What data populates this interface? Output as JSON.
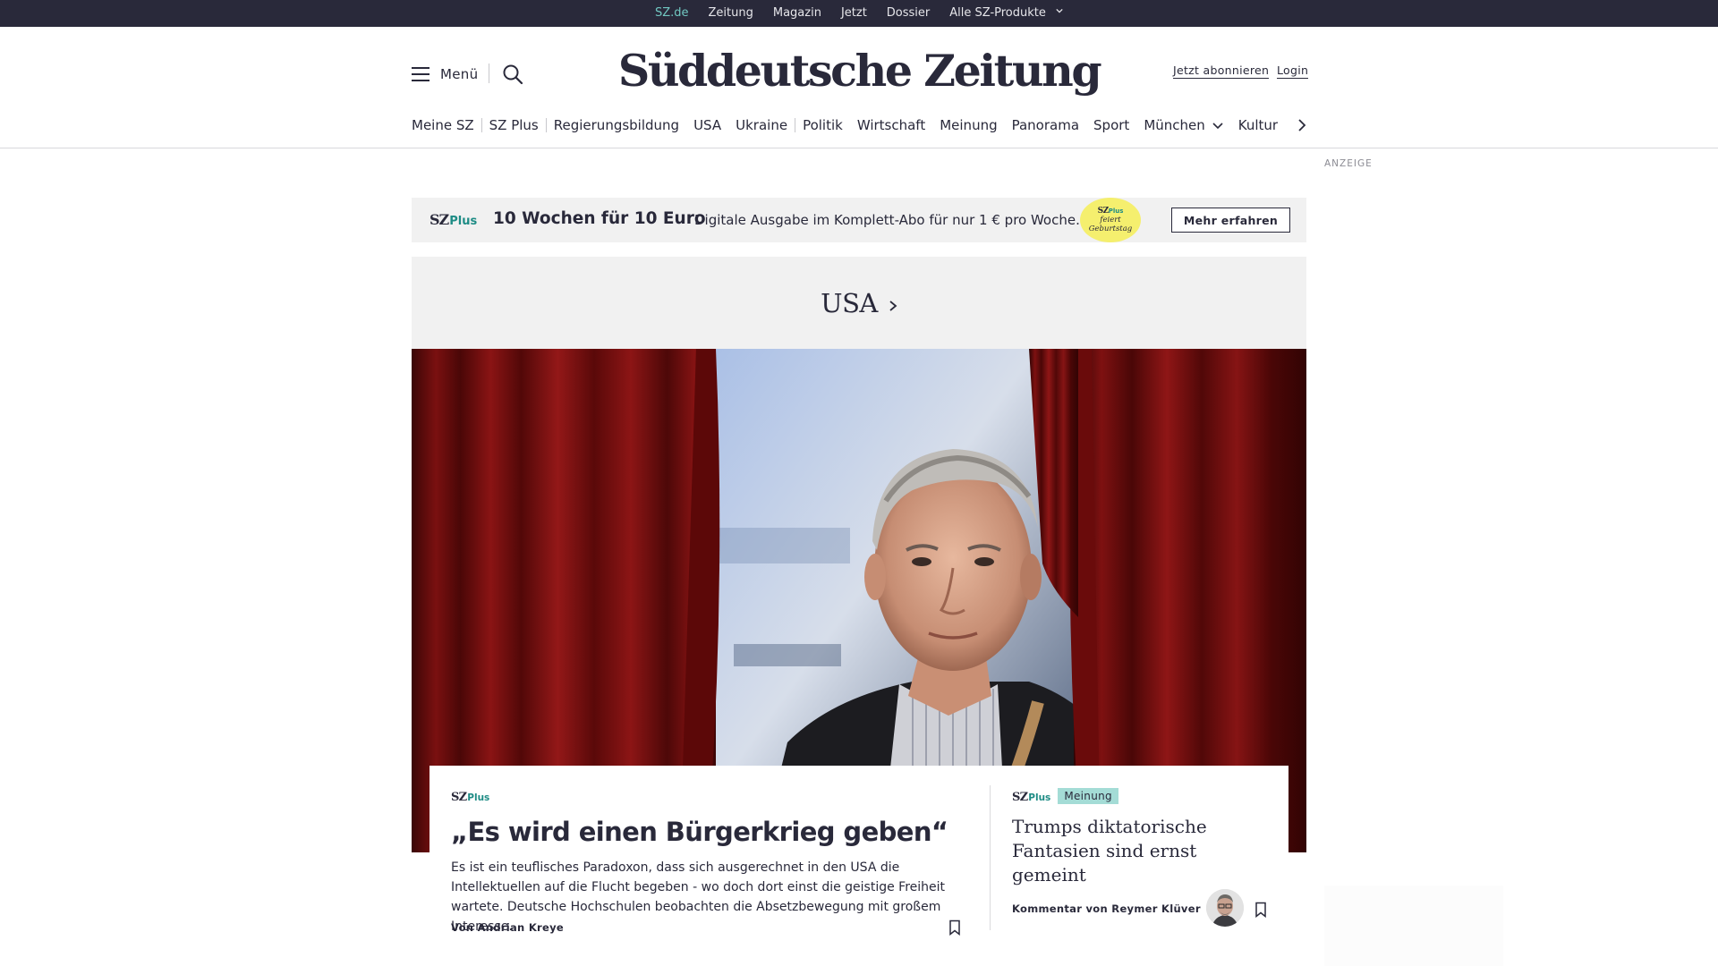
{
  "topbar": {
    "links": [
      "SZ.de",
      "Zeitung",
      "Magazin",
      "Jetzt",
      "Dossier",
      "Alle SZ-Produkte"
    ],
    "active": "SZ.de"
  },
  "header": {
    "menu_label": "Menü",
    "logo": "Süddeutsche Zeitung",
    "subscribe": "Jetzt abonnieren",
    "login": "Login"
  },
  "nav": {
    "items": [
      "Meine SZ",
      "SZ Plus",
      "Regierungsbildung",
      "USA",
      "Ukraine",
      "Politik",
      "Wirtschaft",
      "Meinung",
      "Panorama",
      "Sport",
      "München",
      "Kultur"
    ]
  },
  "ad": {
    "label": "ANZEIGE",
    "logo": "SZ",
    "logo_plus": "Plus",
    "headline": "10 Wochen für 10 Euro",
    "text": "Digitale Ausgabe im Komplett-Abo für nur 1 € pro Woche.",
    "badge_line1": "SZ",
    "badge_plus": "Plus",
    "badge_line2": "feiert",
    "badge_line3": "Geburtstag",
    "button": "Mehr erfahren"
  },
  "section": {
    "title": "USA"
  },
  "lead_article": {
    "tag": "SZ",
    "tag_plus": "Plus",
    "title": "„Es wird einen Bürgerkrieg geben“",
    "teaser": "Es ist ein teuflisches Paradoxon, dass sich ausgerechnet in den USA die Intellektuellen auf die Flucht begeben - wo doch dort einst die geistige Freiheit wartete. Deutsche Hochschulen beobachten die Absetzbewegung mit großem Interesse.",
    "author": "Von Andrian Kreye"
  },
  "side_article": {
    "tag": "SZ",
    "tag_plus": "Plus",
    "badge": "Meinung",
    "title": "Trumps diktatorische Fantasien sind ernst gemeint",
    "author": "Kommentar von Reymer Klüver"
  },
  "colors": {
    "navy": "#29293a",
    "teal": "#71c8c2",
    "plus_green": "#1e8c85",
    "curtain_red": "#7a0f0f",
    "badge_yellow": "#f5ef6e"
  },
  "icons": {
    "menu": "hamburger-icon",
    "search": "search-icon",
    "next": "chevron-right-icon",
    "bookmark": "bookmark-icon"
  }
}
